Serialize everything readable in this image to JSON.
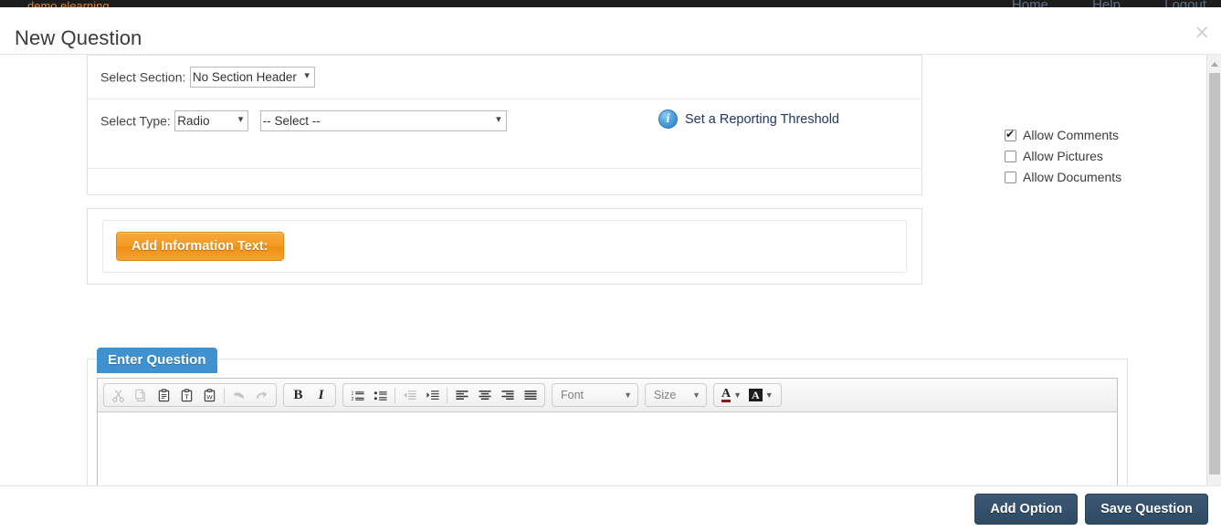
{
  "page": {
    "brand": "demo elearning",
    "nav": [
      "Home",
      "Help",
      "Logout"
    ]
  },
  "modal": {
    "title": "New Question",
    "close_label": "×"
  },
  "form": {
    "section_label": "Select Section:",
    "section_value": "No Section Header",
    "section_options": [
      "No Section Header"
    ],
    "type_label": "Select Type:",
    "type_value": "Radio",
    "type_options": [
      "Radio"
    ],
    "subtype_value": "-- Select --",
    "subtype_options": [
      "-- Select --"
    ],
    "threshold_link": "Set a Reporting Threshold",
    "threshold_icon": "info-icon",
    "add_information_text_label": "Add Information Text:"
  },
  "options_panel": {
    "items": [
      {
        "label": "Allow Comments",
        "checked": true
      },
      {
        "label": "Allow Pictures",
        "checked": false
      },
      {
        "label": "Allow Documents",
        "checked": false
      }
    ]
  },
  "editor": {
    "tab_label": "Enter Question",
    "content": "",
    "font_label": "Font",
    "size_label": "Size",
    "toolbar": [
      {
        "name": "cut-icon",
        "title": "Cut",
        "disabled": true
      },
      {
        "name": "copy-icon",
        "title": "Copy",
        "disabled": true
      },
      {
        "name": "paste-icon",
        "title": "Paste",
        "disabled": false
      },
      {
        "name": "paste-text-icon",
        "title": "Paste as plain text",
        "disabled": false
      },
      {
        "name": "paste-word-icon",
        "title": "Paste from Word",
        "disabled": false
      },
      {
        "name": "undo-icon",
        "title": "Undo",
        "disabled": true
      },
      {
        "name": "redo-icon",
        "title": "Redo",
        "disabled": true
      },
      {
        "name": "bold-icon",
        "title": "Bold",
        "disabled": false
      },
      {
        "name": "italic-icon",
        "title": "Italic",
        "disabled": false
      },
      {
        "name": "numbered-list-icon",
        "title": "Insert/Remove Numbered List",
        "disabled": false
      },
      {
        "name": "bulleted-list-icon",
        "title": "Insert/Remove Bulleted List",
        "disabled": false
      },
      {
        "name": "decrease-indent-icon",
        "title": "Decrease Indent",
        "disabled": true
      },
      {
        "name": "increase-indent-icon",
        "title": "Increase Indent",
        "disabled": false
      },
      {
        "name": "align-left-icon",
        "title": "Align Left",
        "disabled": false
      },
      {
        "name": "align-center-icon",
        "title": "Center",
        "disabled": false
      },
      {
        "name": "align-right-icon",
        "title": "Align Right",
        "disabled": false
      },
      {
        "name": "justify-icon",
        "title": "Justify",
        "disabled": false
      },
      {
        "name": "text-color-icon",
        "title": "Text Color",
        "disabled": false
      },
      {
        "name": "background-color-icon",
        "title": "Background Color",
        "disabled": false
      }
    ],
    "bold_glyph": "B",
    "italic_glyph": "I",
    "color_glyph": "A"
  },
  "footer": {
    "add_option_label": "Add Option",
    "save_question_label": "Save Question"
  },
  "colors": {
    "orange_button": "#f39a22",
    "navy_button": "#2f4a63",
    "tab_blue": "#3f92cf",
    "link_navy": "#1f3864",
    "brand_orange": "#d8883a"
  }
}
